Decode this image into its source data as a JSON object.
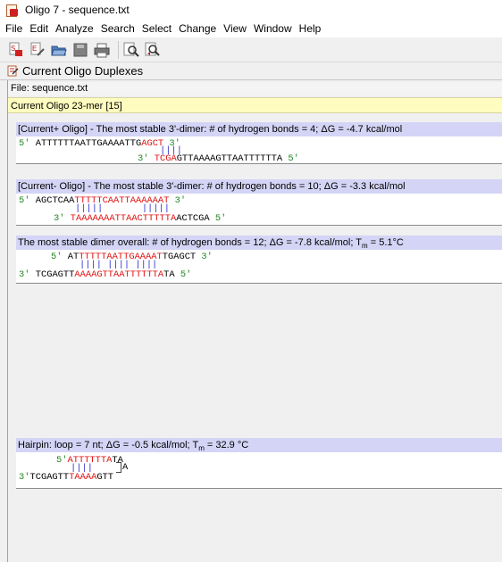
{
  "window": {
    "title": "Oligo 7 - sequence.txt"
  },
  "menu": [
    "File",
    "Edit",
    "Analyze",
    "Search",
    "Select",
    "Change",
    "View",
    "Window",
    "Help"
  ],
  "toolbar_icons": [
    "new-sequence-icon",
    "edit-sequence-icon",
    "open-folder-icon",
    "save-icon",
    "print-icon",
    "find-icon",
    "find-next-icon"
  ],
  "panel": {
    "title": "Current Oligo Duplexes"
  },
  "file_line": "File: sequence.txt",
  "oligo_line": "Current Oligo 23-mer [15]",
  "colors": {
    "header_bg": "#d4d4f6",
    "prime_green": "#228822",
    "match_red": "#e01010",
    "bond_blue": "#3030c8",
    "oligo_bar": "#fffcbf"
  },
  "sections": {
    "s1": {
      "header": "[Current+ Oligo] - The most stable 3'-dimer: # of hydrogen bonds = 4; ΔG = -4.7 kcal/mol",
      "top": {
        "p5": "5'",
        "black1": "ATTTTTTAATTGAAAATTG",
        "red": "AGCT",
        "p3": "3'"
      },
      "bars": "||||",
      "bottom": {
        "p3": "3'",
        "red": "TCGA",
        "black": "GTTAAAAGTTAATTTTTTA",
        "p5": "5'"
      }
    },
    "s2": {
      "header": "[Current- Oligo] - The most stable 3'-dimer: # of hydrogen bonds = 10; ΔG = -3.3 kcal/mol",
      "top": {
        "p5": "5'",
        "black": "AGCTCAA",
        "red": "TTTTTCAATTAAAAAAT",
        "p3": "3'"
      },
      "bars": "|||||       |||||",
      "bottom": {
        "p3": "3'",
        "red": "TAAAAAAATTAACTTTTTA",
        "black": "ACTCGA",
        "p5": "5'"
      }
    },
    "s3": {
      "header_pre": "The most stable dimer overall: # of hydrogen bonds = 12; ΔG = -7.8 kcal/mol; T",
      "header_sub": "m",
      "header_post": " = 5.1°C",
      "top": {
        "p5": "5'",
        "black1": "AT",
        "red": "TTTTTAATTGAAAAT",
        "black2": "TGAGCT",
        "p3": "3'"
      },
      "bars": "|||| |||| ||||",
      "bottom": {
        "p3": "3'",
        "black1": "TCGAGTT",
        "red": "AAAAGTTAATTTTTTA",
        "black2": "TA",
        "p5": "5'"
      }
    },
    "s4": {
      "header_pre": "Hairpin: loop = 7 nt; ΔG = -0.5 kcal/mol; T",
      "header_sub": "m",
      "header_post": " = 32.9 °C",
      "top": {
        "p5": "5'",
        "red": "ATTTTTTA",
        "black": "TA"
      },
      "bars": "||||",
      "loop_char": "A",
      "bottom": {
        "p3": "3'",
        "black1": "TCGAGTT",
        "red": "TAAAA",
        "black2": "GTT"
      }
    }
  }
}
